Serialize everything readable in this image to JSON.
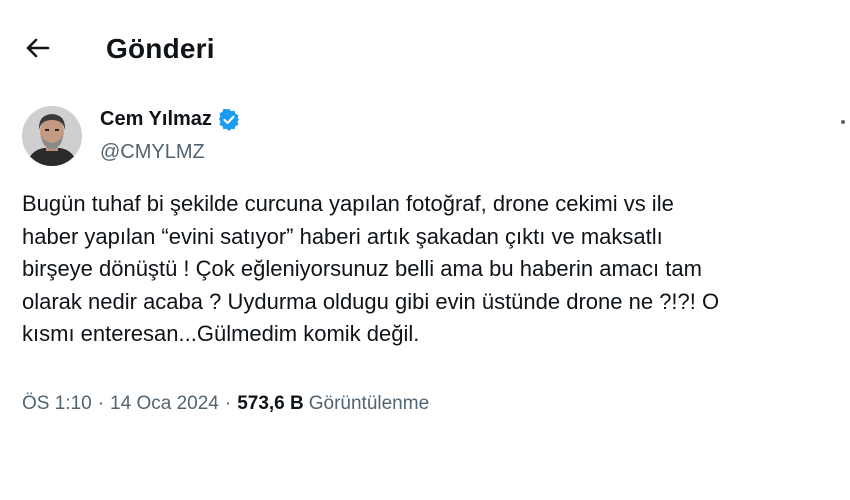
{
  "header": {
    "back_icon": "arrow-left-icon",
    "title": "Gönderi"
  },
  "author": {
    "display_name": "Cem Yılmaz",
    "handle": "@CMYLMZ",
    "verified_icon": "verified-badge-icon",
    "verified_color": "#1d9bf0"
  },
  "tweet": {
    "text": "Bugün tuhaf bi şekilde curcuna yapılan fotoğraf, drone cekimi vs ile\nhaber yapılan “evini satıyor” haberi artık şakadan çıktı ve maksatlı\nbirşeye dönüştü ! Çok eğleniyorsunuz belli ama bu haberin amacı tam\nolarak nedir acaba ? Uydurma oldugu gibi evin üstünde drone ne ?!?! O\nkısmı enteresan...Gülmedim komik değil."
  },
  "meta": {
    "time": "ÖS 1:10",
    "separator": "·",
    "date": "14 Oca 2024",
    "views_count": "573,6 B",
    "views_label": "Görüntülenme"
  },
  "colors": {
    "text_primary": "#0f1419",
    "text_secondary": "#536471",
    "accent": "#1d9bf0",
    "background": "#ffffff"
  }
}
